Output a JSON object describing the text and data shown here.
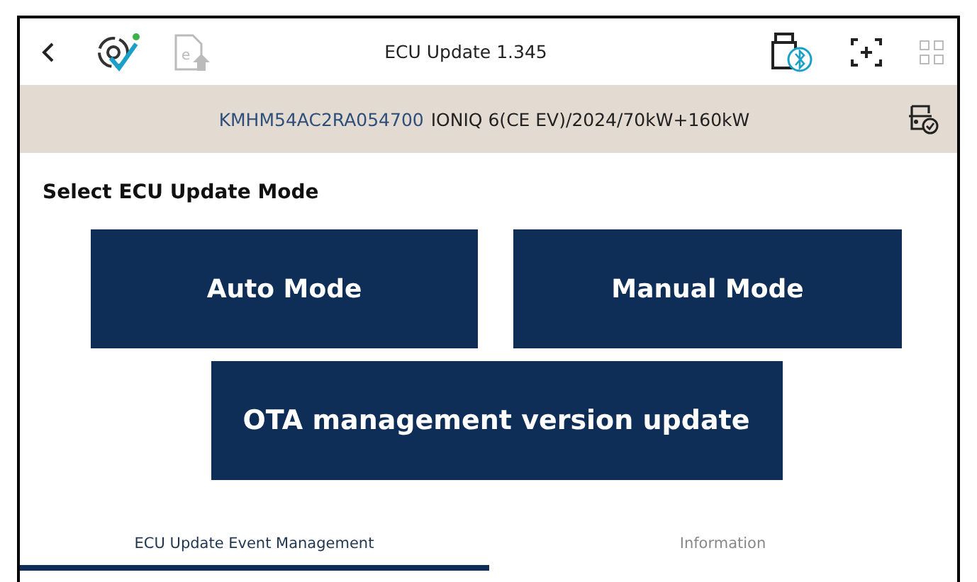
{
  "toolbar": {
    "title": "ECU Update 1.345",
    "sync_status_dot": true,
    "upload_icon_letter": "e"
  },
  "vehicle": {
    "vin": "KMHM54AC2RA054700",
    "description": "IONIQ 6(CE EV)/2024/70kW+160kW"
  },
  "heading": "Select ECU Update Mode",
  "mode_buttons": [
    {
      "label": "Auto Mode"
    },
    {
      "label": "Manual Mode"
    },
    {
      "label": "OTA management version update"
    }
  ],
  "tabs": [
    {
      "label": "ECU Update Event Management",
      "selected": true
    },
    {
      "label": "Information",
      "selected": false
    }
  ]
}
